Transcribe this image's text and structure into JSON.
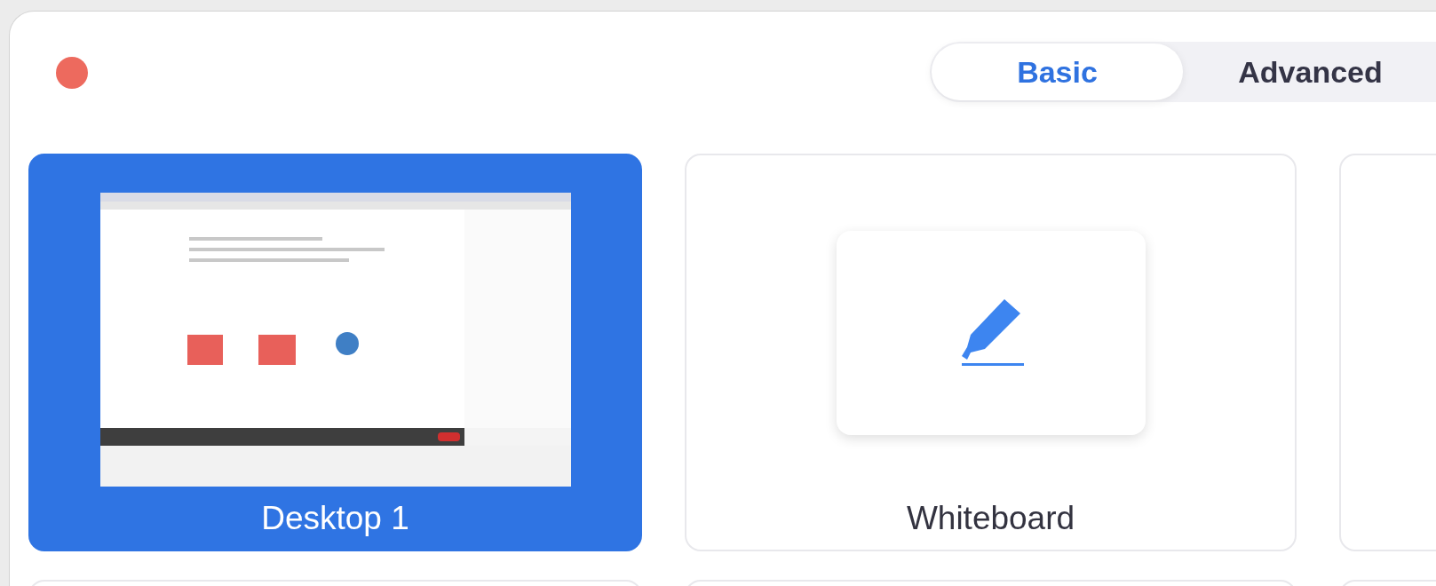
{
  "tabs": [
    {
      "label": "Basic",
      "selected": true
    },
    {
      "label": "Advanced",
      "selected": false
    }
  ],
  "options": [
    {
      "kind": "screen",
      "label": "Desktop 1",
      "selected": true
    },
    {
      "kind": "whiteboard",
      "label": "Whiteboard",
      "selected": false
    },
    {
      "kind": "empty",
      "selected": false
    },
    {
      "kind": "empty",
      "selected": false
    },
    {
      "kind": "empty",
      "selected": false
    },
    {
      "kind": "empty",
      "selected": false
    }
  ]
}
